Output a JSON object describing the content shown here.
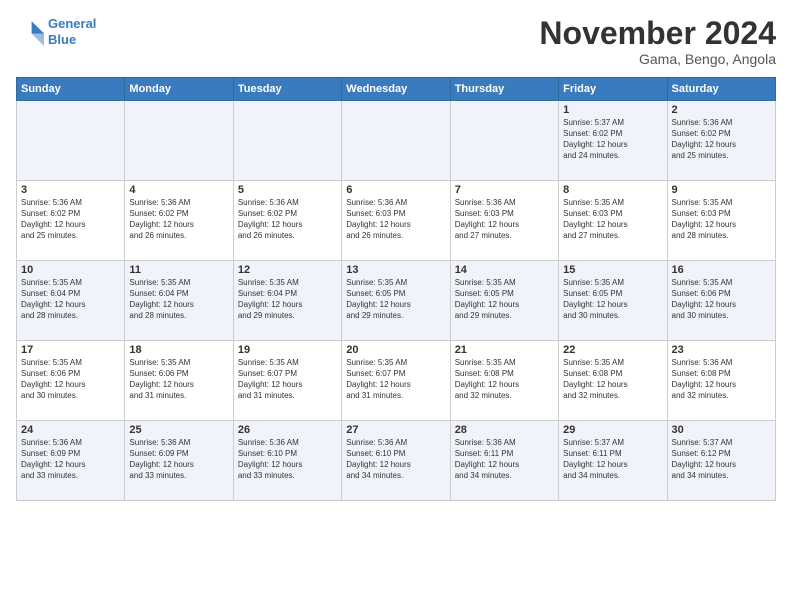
{
  "logo": {
    "line1": "General",
    "line2": "Blue"
  },
  "header": {
    "title": "November 2024",
    "subtitle": "Gama, Bengo, Angola"
  },
  "weekdays": [
    "Sunday",
    "Monday",
    "Tuesday",
    "Wednesday",
    "Thursday",
    "Friday",
    "Saturday"
  ],
  "weeks": [
    [
      {
        "day": "",
        "info": ""
      },
      {
        "day": "",
        "info": ""
      },
      {
        "day": "",
        "info": ""
      },
      {
        "day": "",
        "info": ""
      },
      {
        "day": "",
        "info": ""
      },
      {
        "day": "1",
        "info": "Sunrise: 5:37 AM\nSunset: 6:02 PM\nDaylight: 12 hours\nand 24 minutes."
      },
      {
        "day": "2",
        "info": "Sunrise: 5:36 AM\nSunset: 6:02 PM\nDaylight: 12 hours\nand 25 minutes."
      }
    ],
    [
      {
        "day": "3",
        "info": "Sunrise: 5:36 AM\nSunset: 6:02 PM\nDaylight: 12 hours\nand 25 minutes."
      },
      {
        "day": "4",
        "info": "Sunrise: 5:36 AM\nSunset: 6:02 PM\nDaylight: 12 hours\nand 26 minutes."
      },
      {
        "day": "5",
        "info": "Sunrise: 5:36 AM\nSunset: 6:02 PM\nDaylight: 12 hours\nand 26 minutes."
      },
      {
        "day": "6",
        "info": "Sunrise: 5:36 AM\nSunset: 6:03 PM\nDaylight: 12 hours\nand 26 minutes."
      },
      {
        "day": "7",
        "info": "Sunrise: 5:36 AM\nSunset: 6:03 PM\nDaylight: 12 hours\nand 27 minutes."
      },
      {
        "day": "8",
        "info": "Sunrise: 5:35 AM\nSunset: 6:03 PM\nDaylight: 12 hours\nand 27 minutes."
      },
      {
        "day": "9",
        "info": "Sunrise: 5:35 AM\nSunset: 6:03 PM\nDaylight: 12 hours\nand 28 minutes."
      }
    ],
    [
      {
        "day": "10",
        "info": "Sunrise: 5:35 AM\nSunset: 6:04 PM\nDaylight: 12 hours\nand 28 minutes."
      },
      {
        "day": "11",
        "info": "Sunrise: 5:35 AM\nSunset: 6:04 PM\nDaylight: 12 hours\nand 28 minutes."
      },
      {
        "day": "12",
        "info": "Sunrise: 5:35 AM\nSunset: 6:04 PM\nDaylight: 12 hours\nand 29 minutes."
      },
      {
        "day": "13",
        "info": "Sunrise: 5:35 AM\nSunset: 6:05 PM\nDaylight: 12 hours\nand 29 minutes."
      },
      {
        "day": "14",
        "info": "Sunrise: 5:35 AM\nSunset: 6:05 PM\nDaylight: 12 hours\nand 29 minutes."
      },
      {
        "day": "15",
        "info": "Sunrise: 5:35 AM\nSunset: 6:05 PM\nDaylight: 12 hours\nand 30 minutes."
      },
      {
        "day": "16",
        "info": "Sunrise: 5:35 AM\nSunset: 6:06 PM\nDaylight: 12 hours\nand 30 minutes."
      }
    ],
    [
      {
        "day": "17",
        "info": "Sunrise: 5:35 AM\nSunset: 6:06 PM\nDaylight: 12 hours\nand 30 minutes."
      },
      {
        "day": "18",
        "info": "Sunrise: 5:35 AM\nSunset: 6:06 PM\nDaylight: 12 hours\nand 31 minutes."
      },
      {
        "day": "19",
        "info": "Sunrise: 5:35 AM\nSunset: 6:07 PM\nDaylight: 12 hours\nand 31 minutes."
      },
      {
        "day": "20",
        "info": "Sunrise: 5:35 AM\nSunset: 6:07 PM\nDaylight: 12 hours\nand 31 minutes."
      },
      {
        "day": "21",
        "info": "Sunrise: 5:35 AM\nSunset: 6:08 PM\nDaylight: 12 hours\nand 32 minutes."
      },
      {
        "day": "22",
        "info": "Sunrise: 5:35 AM\nSunset: 6:08 PM\nDaylight: 12 hours\nand 32 minutes."
      },
      {
        "day": "23",
        "info": "Sunrise: 5:36 AM\nSunset: 6:08 PM\nDaylight: 12 hours\nand 32 minutes."
      }
    ],
    [
      {
        "day": "24",
        "info": "Sunrise: 5:36 AM\nSunset: 6:09 PM\nDaylight: 12 hours\nand 33 minutes."
      },
      {
        "day": "25",
        "info": "Sunrise: 5:36 AM\nSunset: 6:09 PM\nDaylight: 12 hours\nand 33 minutes."
      },
      {
        "day": "26",
        "info": "Sunrise: 5:36 AM\nSunset: 6:10 PM\nDaylight: 12 hours\nand 33 minutes."
      },
      {
        "day": "27",
        "info": "Sunrise: 5:36 AM\nSunset: 6:10 PM\nDaylight: 12 hours\nand 34 minutes."
      },
      {
        "day": "28",
        "info": "Sunrise: 5:36 AM\nSunset: 6:11 PM\nDaylight: 12 hours\nand 34 minutes."
      },
      {
        "day": "29",
        "info": "Sunrise: 5:37 AM\nSunset: 6:11 PM\nDaylight: 12 hours\nand 34 minutes."
      },
      {
        "day": "30",
        "info": "Sunrise: 5:37 AM\nSunset: 6:12 PM\nDaylight: 12 hours\nand 34 minutes."
      }
    ]
  ]
}
